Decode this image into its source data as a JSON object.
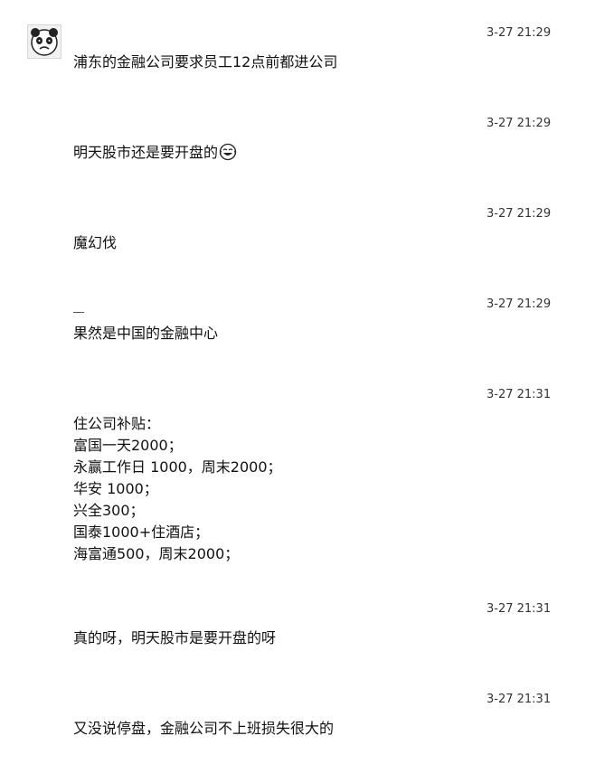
{
  "chat": {
    "avatar_icon": "panda-meme-avatar",
    "messages": [
      {
        "time": "3-27 21:29",
        "text": "浦东的金融公司要求员工12点前都进公司"
      },
      {
        "time": "3-27 21:29",
        "text": "明天股市还是要开盘的",
        "emoji": "laughing-tears-emoji"
      },
      {
        "time": "3-27 21:29",
        "text": "魔幻伐"
      },
      {
        "time": "3-27 21:29",
        "text": "果然是中国的金融中心"
      },
      {
        "time": "3-27 21:31",
        "lines": [
          "住公司补贴：",
          "富国一天2000；",
          "永赢工作日 1000，周末2000；",
          "华安 1000；",
          "兴全300；",
          "国泰1000+住酒店；",
          "海富通500，周末2000；"
        ]
      },
      {
        "time": "3-27 21:31",
        "text": "真的呀，明天股市是要开盘的呀"
      },
      {
        "time": "3-27 21:31",
        "text": "又没说停盘，金融公司不上班损失很大的"
      }
    ]
  }
}
